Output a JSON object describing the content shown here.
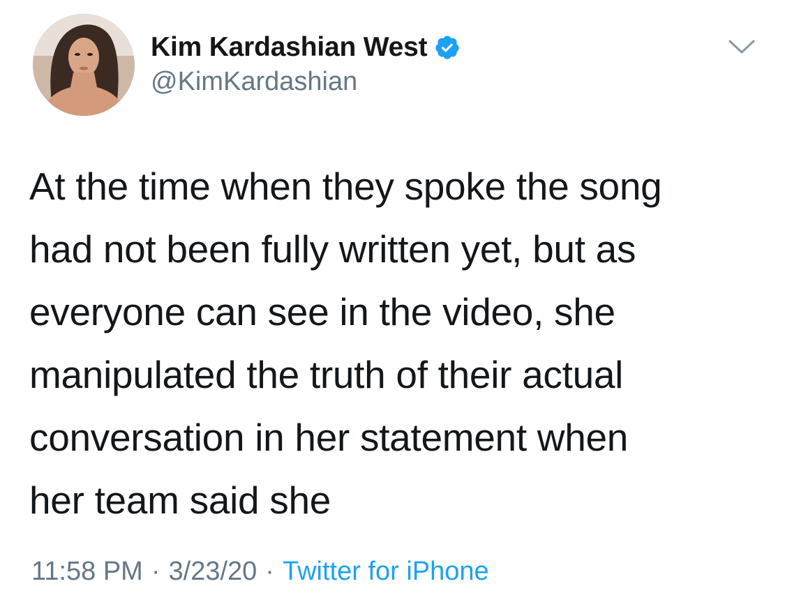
{
  "author": {
    "display_name": "Kim Kardashian West",
    "handle": "@KimKardashian",
    "verified_icon": "verified-badge-icon",
    "avatar_alt": "profile photo"
  },
  "menu": {
    "icon": "chevron-down-icon"
  },
  "tweet": {
    "lines": [
      "At the time when they spoke the song",
      "had not been fully written yet, but as",
      "everyone can see in the video, she",
      "manipulated the truth of their actual",
      "conversation in her statement when",
      "her team said she"
    ]
  },
  "meta": {
    "time": "11:58 PM",
    "separator": "·",
    "date": "3/23/20",
    "source": "Twitter for iPhone"
  },
  "colors": {
    "text": "#14171a",
    "secondary": "#657786",
    "accent": "#1da1f2",
    "background": "#ffffff"
  }
}
